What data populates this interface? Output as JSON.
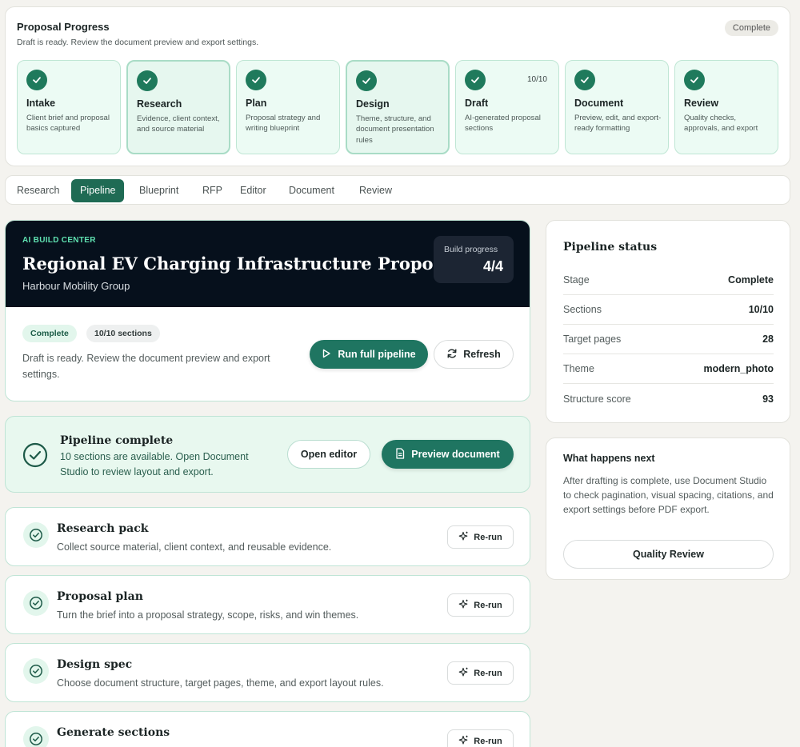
{
  "progress": {
    "title": "Proposal Progress",
    "subtitle": "Draft is ready. Review the document preview and export settings.",
    "status_badge": "Complete",
    "steps": [
      {
        "label": "Intake",
        "desc": "Client brief and proposal basics captured",
        "count": ""
      },
      {
        "label": "Research",
        "desc": "Evidence, client context, and source material",
        "count": ""
      },
      {
        "label": "Plan",
        "desc": "Proposal strategy and writing blueprint",
        "count": ""
      },
      {
        "label": "Design",
        "desc": "Theme, structure, and document presentation rules",
        "count": ""
      },
      {
        "label": "Draft",
        "desc": "AI-generated proposal sections",
        "count": "10/10"
      },
      {
        "label": "Document",
        "desc": "Preview, edit, and export-ready formatting",
        "count": ""
      },
      {
        "label": "Review",
        "desc": "Quality checks, approvals, and export",
        "count": ""
      }
    ]
  },
  "tabs": [
    "Research",
    "Pipeline",
    "Blueprint",
    "RFP",
    "Editor",
    "Document",
    "Review"
  ],
  "active_tab": "Pipeline",
  "hero": {
    "eyebrow": "AI BUILD CENTER",
    "title": "Regional EV Charging Infrastructure Proposal",
    "client": "Harbour Mobility Group",
    "build_progress_label": "Build progress",
    "build_progress_value": "4/4",
    "status_pill": "Complete",
    "sections_pill": "10/10 sections",
    "description": "Draft is ready. Review the document preview and export settings.",
    "run_button": "Run full pipeline",
    "refresh_button": "Refresh"
  },
  "banner": {
    "title": "Pipeline complete",
    "text": "10 sections are available. Open Document Studio to review layout and export.",
    "open_editor": "Open editor",
    "preview_document": "Preview document"
  },
  "stages": [
    {
      "title": "Research pack",
      "desc": "Collect source material, client context, and reusable evidence.",
      "button": "Re-run"
    },
    {
      "title": "Proposal plan",
      "desc": "Turn the brief into a proposal strategy, scope, risks, and win themes.",
      "button": "Re-run"
    },
    {
      "title": "Design spec",
      "desc": "Choose document structure, target pages, theme, and export layout rules.",
      "button": "Re-run"
    },
    {
      "title": "Generate sections",
      "desc": "",
      "button": "Re-run"
    }
  ],
  "pipeline_status": {
    "title": "Pipeline status",
    "rows": [
      {
        "key": "Stage",
        "value": "Complete"
      },
      {
        "key": "Sections",
        "value": "10/10"
      },
      {
        "key": "Target pages",
        "value": "28"
      },
      {
        "key": "Theme",
        "value": "modern_photo"
      },
      {
        "key": "Structure score",
        "value": "93"
      }
    ]
  },
  "next": {
    "title": "What happens next",
    "text": "After drafting is complete, use Document Studio to check pagination, visual spacing, citations, and export settings before PDF export.",
    "button": "Quality Review"
  },
  "colors": {
    "accent": "#1f7561",
    "dark_header": "#06101c",
    "eyebrow": "#5fe0b0",
    "step_bg": "#ecfbf4"
  }
}
